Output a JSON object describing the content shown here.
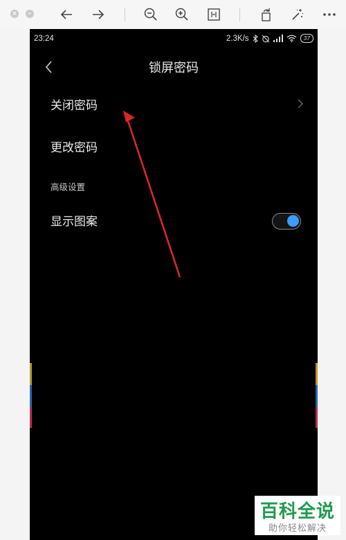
{
  "toolbar": {
    "icons": [
      "close-dot",
      "minimize-dot",
      "arrow-left-icon",
      "arrow-right-icon",
      "zoom-out-icon",
      "zoom-in-icon",
      "fit-icon",
      "rotate-icon",
      "magic-wand-icon",
      "more-icon"
    ]
  },
  "status_bar": {
    "time": "23:24",
    "network_speed": "2.3K/s",
    "battery": "37"
  },
  "header": {
    "title": "锁屏密码"
  },
  "settings": {
    "items": [
      {
        "label": "关闭密码",
        "has_chevron": true
      },
      {
        "label": "更改密码",
        "has_chevron": false
      }
    ],
    "section_title": "高级设置",
    "toggle_item": {
      "label": "显示图案",
      "enabled": true
    }
  },
  "colors": {
    "toggle_on": "#3d9bff",
    "annotation_arrow": "#d9262b",
    "watermark_green": "#1f9a4e"
  },
  "watermark": {
    "title": "百科全说",
    "subtitle": "助你轻松解决"
  }
}
